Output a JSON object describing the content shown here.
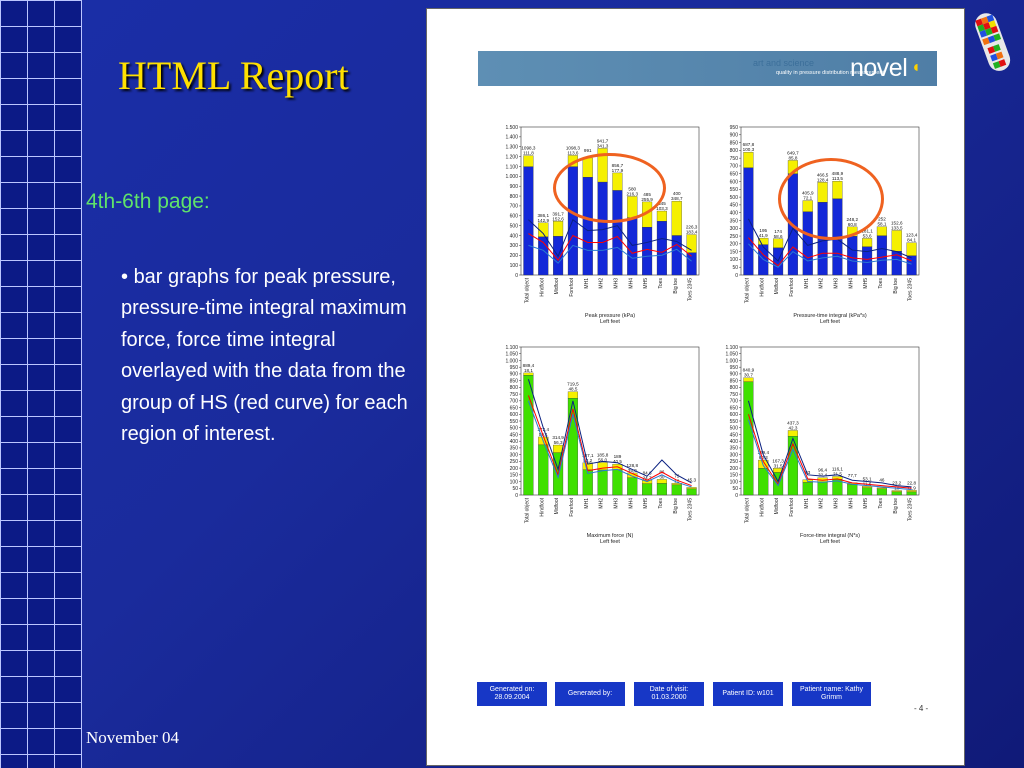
{
  "slide": {
    "title": "HTML Report",
    "subtitle": "4th-6th page:",
    "bullet": "bar graphs for peak pressure, pressure-time integral maximum force, force time integral overlayed with the data from the group of HS (red curve) for each region of interest.",
    "footer": "November 04",
    "colors": {
      "background": "#1a2b9c",
      "title": "#ffe000",
      "subtitle": "#5fe36a",
      "highlight": "#ef6220"
    }
  },
  "report": {
    "banner": {
      "tagline_a": "art and science",
      "tagline_b": "quality in pressure distribution measurement",
      "logo_text": "novel",
      "logo_icon": "foot-logo-icon"
    },
    "info": [
      {
        "label": "Generated on:",
        "value": "28.09.2004"
      },
      {
        "label": "Generated by:",
        "value": ""
      },
      {
        "label": "Date of visit:",
        "value": "01.03.2000"
      },
      {
        "label": "Patient ID: w101",
        "value": ""
      },
      {
        "label": "Patient name: Kathy",
        "value": "Grimm"
      }
    ],
    "page_number": "- 4 -"
  },
  "chart_data": [
    {
      "type": "bar",
      "title": "Peak pressure (kPa)",
      "subtitle": "Left feet",
      "categories": [
        "Total object",
        "Hindfoot",
        "Midfoot",
        "Forefoot",
        "MH1",
        "MH2",
        "MH3",
        "MH4",
        "MH5",
        "Toes",
        "Big toe",
        "Toes 2345"
      ],
      "series": [
        {
          "name": "mean",
          "color": "#1328d8",
          "values": [
            1098.3,
            386.1,
            391.7,
            1098.3,
            991,
            941.7,
            856.7,
            580,
            485,
            545,
            400,
            226.3
          ]
        },
        {
          "name": "sd",
          "color": "#f5f000",
          "values": [
            111.8,
            142.9,
            152.6,
            113.6,
            195.6,
            341.3,
            177.9,
            216.3,
            255.9,
            103.3,
            348.7,
            183.4
          ]
        }
      ],
      "ylim": [
        0,
        1500
      ],
      "yticks": [
        "0",
        "100",
        "200",
        "300",
        "400",
        "500",
        "600",
        "700",
        "800",
        "900",
        "1.000",
        "1.100",
        "1.200",
        "1.300",
        "1.400",
        "1.500"
      ],
      "bar_labels": [
        [
          "1098,3",
          "111,8"
        ],
        [
          "386,1",
          "142,9"
        ],
        [
          "391,7",
          "152,6"
        ],
        [
          "1098,3",
          "113,6"
        ],
        [
          "991",
          ""
        ],
        [
          "941,7",
          "341,3"
        ],
        [
          "856,7",
          "177,9"
        ],
        [
          "580",
          "216,3"
        ],
        [
          "485",
          "255,9"
        ],
        [
          "545",
          "103,3"
        ],
        [
          "400",
          "348,7"
        ],
        [
          "226,3",
          "183,4"
        ]
      ],
      "overlay_lines": [
        {
          "color": "#ff0000",
          "values": [
            420,
            330,
            150,
            400,
            330,
            330,
            390,
            220,
            260,
            230,
            310,
            190
          ]
        },
        {
          "color": "#0a2080",
          "values": [
            560,
            420,
            190,
            560,
            450,
            460,
            500,
            300,
            330,
            370,
            340,
            250
          ]
        },
        {
          "color": "#2a7ad0",
          "values": [
            300,
            250,
            120,
            300,
            250,
            250,
            280,
            170,
            190,
            200,
            260,
            140
          ]
        }
      ]
    },
    {
      "type": "bar",
      "title": "Pressure-time integral (kPa*s)",
      "subtitle": "Left feet",
      "categories": [
        "Total object",
        "Hindfoot",
        "Midfoot",
        "Forefoot",
        "MH1",
        "MH2",
        "MH3",
        "MH4",
        "MH5",
        "Toes",
        "Big toe",
        "Toes 2345"
      ],
      "series": [
        {
          "name": "mean",
          "color": "#1328d8",
          "values": [
            687.8,
            195,
            174,
            649.7,
            405.9,
            466.5,
            488.9,
            248.2,
            181.1,
            252,
            152.6,
            123.4
          ]
        },
        {
          "name": "sd",
          "color": "#f5f000",
          "values": [
            100.3,
            41.9,
            58.6,
            85.8,
            72.1,
            128.4,
            113.5,
            60.8,
            53.6,
            58.1,
            133.5,
            84.1
          ]
        }
      ],
      "ylim": [
        0,
        950
      ],
      "yticks": [
        "0",
        "50",
        "100",
        "150",
        "200",
        "250",
        "300",
        "350",
        "400",
        "450",
        "500",
        "550",
        "600",
        "650",
        "700",
        "750",
        "800",
        "850",
        "900",
        "950"
      ],
      "bar_labels": [
        [
          "687,8",
          "100,3"
        ],
        [
          "195",
          "41,9"
        ],
        [
          "174",
          "58,6"
        ],
        [
          "649,7",
          "85,8"
        ],
        [
          "405,9",
          "72,1"
        ],
        [
          "466,5",
          "128,4"
        ],
        [
          "488,9",
          "113,5"
        ],
        [
          "248,2",
          "60,8"
        ],
        [
          "181,1",
          "53,6"
        ],
        [
          "252",
          "58,1"
        ],
        [
          "152,6",
          "133,5"
        ],
        [
          "123,4",
          "84,1"
        ]
      ],
      "overlay_lines": [
        {
          "color": "#ff0000",
          "values": [
            240,
            130,
            60,
            180,
            110,
            140,
            140,
            110,
            100,
            115,
            130,
            90
          ]
        },
        {
          "color": "#0a2080",
          "values": [
            360,
            180,
            90,
            300,
            190,
            220,
            230,
            160,
            150,
            170,
            150,
            110
          ]
        },
        {
          "color": "#2a7ad0",
          "values": [
            200,
            100,
            50,
            150,
            90,
            110,
            120,
            90,
            80,
            95,
            100,
            70
          ]
        }
      ]
    },
    {
      "type": "bar",
      "title": "Maximum force (N)",
      "subtitle": "Left feet",
      "categories": [
        "Total object",
        "Hindfoot",
        "Midfoot",
        "Forefoot",
        "MH1",
        "MH2",
        "MH3",
        "MH4",
        "MH5",
        "Toes",
        "Big toe",
        "Toes 2345"
      ],
      "series": [
        {
          "name": "mean",
          "color": "#3fe000",
          "values": [
            889.4,
            372.4,
            314.9,
            719.5,
            187.1,
            185.8,
            189,
            128.8,
            84.6,
            86,
            75,
            45.3
          ]
        },
        {
          "name": "sd",
          "color": "#f5f000",
          "values": [
            18.1,
            59.1,
            56.3,
            48.5,
            52.2,
            56,
            40.5,
            35,
            24.7,
            30,
            12,
            11
          ]
        }
      ],
      "ylim": [
        0,
        1100
      ],
      "yticks": [
        "0",
        "50",
        "100",
        "150",
        "200",
        "250",
        "300",
        "350",
        "400",
        "450",
        "500",
        "550",
        "600",
        "650",
        "700",
        "750",
        "800",
        "850",
        "900",
        "950",
        "1.000",
        "1.050",
        "1.100"
      ],
      "bar_labels": [
        [
          "889,4",
          "18,1"
        ],
        [
          "372,4",
          "59,1"
        ],
        [
          "314,9",
          "56,3"
        ],
        [
          "719,5",
          "48,5"
        ],
        [
          "187,1",
          "52,2"
        ],
        [
          "185,8",
          "56,0"
        ],
        [
          "189",
          "40,5"
        ],
        [
          "128,8",
          "35,0"
        ],
        [
          "84,6",
          "24,7"
        ],
        [
          "86",
          "30"
        ],
        [
          "75",
          "12"
        ],
        [
          "45,3",
          ""
        ]
      ],
      "overlay_lines": [
        {
          "color": "#ff0000",
          "values": [
            740,
            440,
            150,
            640,
            180,
            200,
            210,
            160,
            110,
            170,
            110,
            70
          ]
        },
        {
          "color": "#0a2080",
          "values": [
            860,
            500,
            190,
            700,
            230,
            250,
            240,
            190,
            140,
            260,
            150,
            90
          ]
        },
        {
          "color": "#2a7ad0",
          "values": [
            700,
            400,
            130,
            600,
            160,
            180,
            190,
            140,
            100,
            150,
            95,
            60
          ]
        }
      ]
    },
    {
      "type": "bar",
      "title": "Force-time integral (N*s)",
      "subtitle": "Left feet",
      "categories": [
        "Total object",
        "Hindfoot",
        "Midfoot",
        "Forefoot",
        "MH1",
        "MH2",
        "MH3",
        "MH4",
        "MH5",
        "Toes",
        "Big toe",
        "Toes 2345"
      ],
      "series": [
        {
          "name": "mean",
          "color": "#3fe000",
          "values": [
            840.9,
            199.4,
            167.3,
            437.3,
            93,
            96.4,
            116.1,
            77.7,
            53.1,
            46,
            23.2,
            22.8
          ]
        },
        {
          "name": "sd",
          "color": "#f5f000",
          "values": [
            30.7,
            60.3,
            31.5,
            42.3,
            20,
            32.4,
            21.5,
            13,
            11.6,
            8,
            10,
            11.9
          ]
        }
      ],
      "ylim": [
        0,
        1100
      ],
      "yticks": [
        "0",
        "50",
        "100",
        "150",
        "200",
        "250",
        "300",
        "350",
        "400",
        "450",
        "500",
        "550",
        "600",
        "650",
        "700",
        "750",
        "800",
        "850",
        "900",
        "950",
        "1.000",
        "1.050",
        "1.100"
      ],
      "bar_labels": [
        [
          "840,9",
          "30,7"
        ],
        [
          "199,4",
          "60,3"
        ],
        [
          "167,3",
          "31,5"
        ],
        [
          "437,3",
          "42,3"
        ],
        [
          "93",
          ""
        ],
        [
          "96,4",
          "32,4"
        ],
        [
          "116,1",
          "21,5"
        ],
        [
          "77,7",
          ""
        ],
        [
          "53,1",
          "11,6"
        ],
        [
          "46",
          ""
        ],
        [
          "23,2",
          "10"
        ],
        [
          "22,8",
          "11,9"
        ]
      ],
      "overlay_lines": [
        {
          "color": "#ff0000",
          "values": [
            600,
            250,
            80,
            380,
            120,
            110,
            120,
            90,
            80,
            70,
            60,
            50
          ]
        },
        {
          "color": "#0a2080",
          "values": [
            700,
            300,
            100,
            420,
            150,
            140,
            150,
            110,
            100,
            90,
            70,
            60
          ]
        },
        {
          "color": "#2a7ad0",
          "values": [
            560,
            220,
            70,
            340,
            100,
            95,
            105,
            80,
            70,
            60,
            50,
            40
          ]
        }
      ]
    }
  ]
}
